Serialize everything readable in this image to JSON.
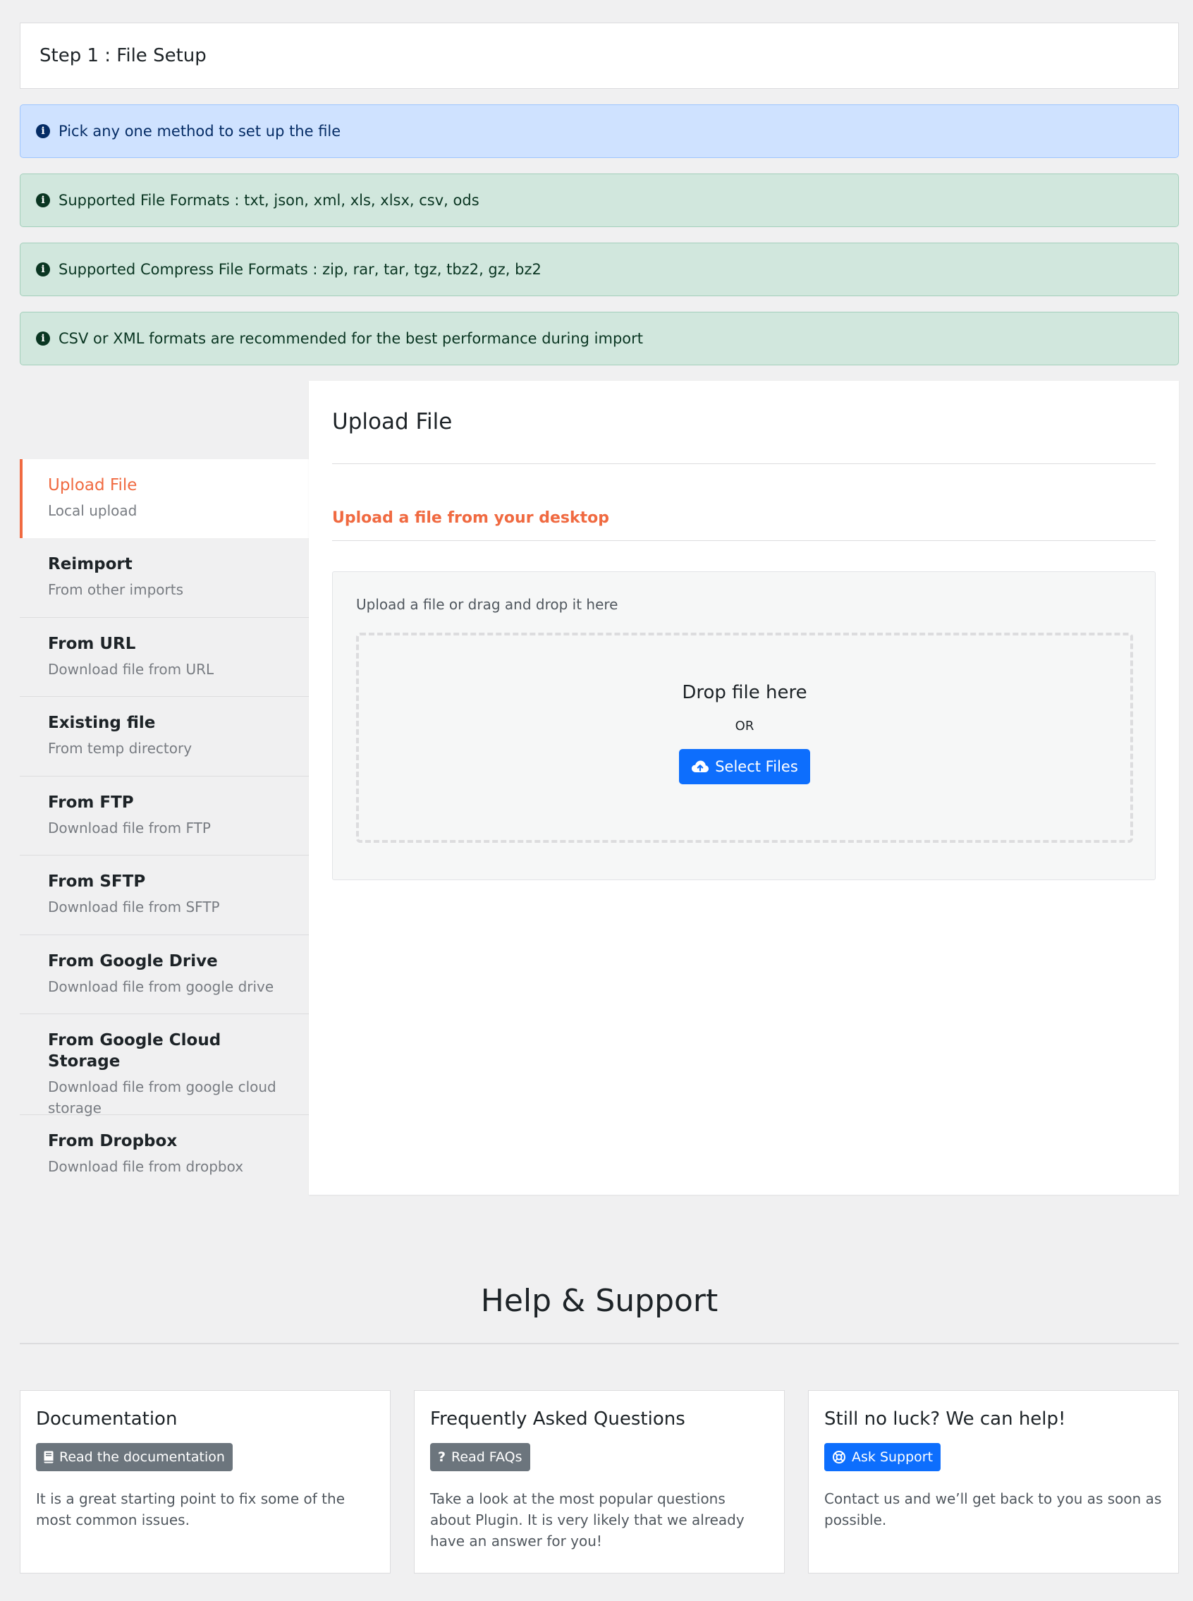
{
  "step": {
    "title": "Step 1 : File Setup"
  },
  "alerts": [
    {
      "type": "info",
      "icon": "info-circle-icon",
      "text": "Pick any one method to set up the file"
    },
    {
      "type": "success",
      "icon": "info-circle-icon",
      "text": "Supported File Formats : txt, json, xml, xls, xlsx, csv, ods"
    },
    {
      "type": "success",
      "icon": "info-circle-icon",
      "text": "Supported Compress File Formats : zip, rar, tar, tgz, tbz2, gz, bz2"
    },
    {
      "type": "success",
      "icon": "info-circle-icon",
      "text": "CSV or XML formats are recommended for the best performance during import"
    }
  ],
  "sidebar": {
    "items": [
      {
        "title": "Upload File",
        "subtitle": "Local upload",
        "active": true
      },
      {
        "title": "Reimport",
        "subtitle": "From other imports"
      },
      {
        "title": "From URL",
        "subtitle": "Download file from URL"
      },
      {
        "title": "Existing file",
        "subtitle": "From temp directory"
      },
      {
        "title": "From FTP",
        "subtitle": "Download file from FTP"
      },
      {
        "title": "From SFTP",
        "subtitle": "Download file from SFTP"
      },
      {
        "title": "From Google Drive",
        "subtitle": "Download file from google drive"
      },
      {
        "title": "From Google Cloud Storage",
        "subtitle": "Download file from google cloud storage"
      },
      {
        "title": "From Dropbox",
        "subtitle": "Download file from dropbox"
      }
    ]
  },
  "panel": {
    "title": "Upload File",
    "subtitle": "Upload a file from your desktop",
    "hint": "Upload a file or drag and drop it here",
    "drop_title": "Drop file here",
    "or": "OR",
    "select_button": "Select Files",
    "select_icon": "cloud-upload-icon"
  },
  "help": {
    "title": "Help & Support",
    "cards": [
      {
        "title": "Documentation",
        "button": "Read the documentation",
        "button_icon": "book-icon",
        "text": "It is a great starting point to fix some of the most common issues."
      },
      {
        "title": "Frequently Asked Questions",
        "button": "Read FAQs",
        "button_icon": "question-icon",
        "text": "Take a look at the most popular questions about Plugin. It is very likely that we already have an answer for you!"
      },
      {
        "title": "Still no luck? We can help!",
        "button": "Ask Support",
        "button_icon": "life-ring-icon",
        "text": "Contact us and we’ll get back to you as soon as possible."
      }
    ]
  },
  "colors": {
    "accent": "#f06a41",
    "primary": "#0d6efd",
    "secondary": "#6c757d",
    "info_bg": "#cfe2ff",
    "success_bg": "#d1e7dd"
  }
}
